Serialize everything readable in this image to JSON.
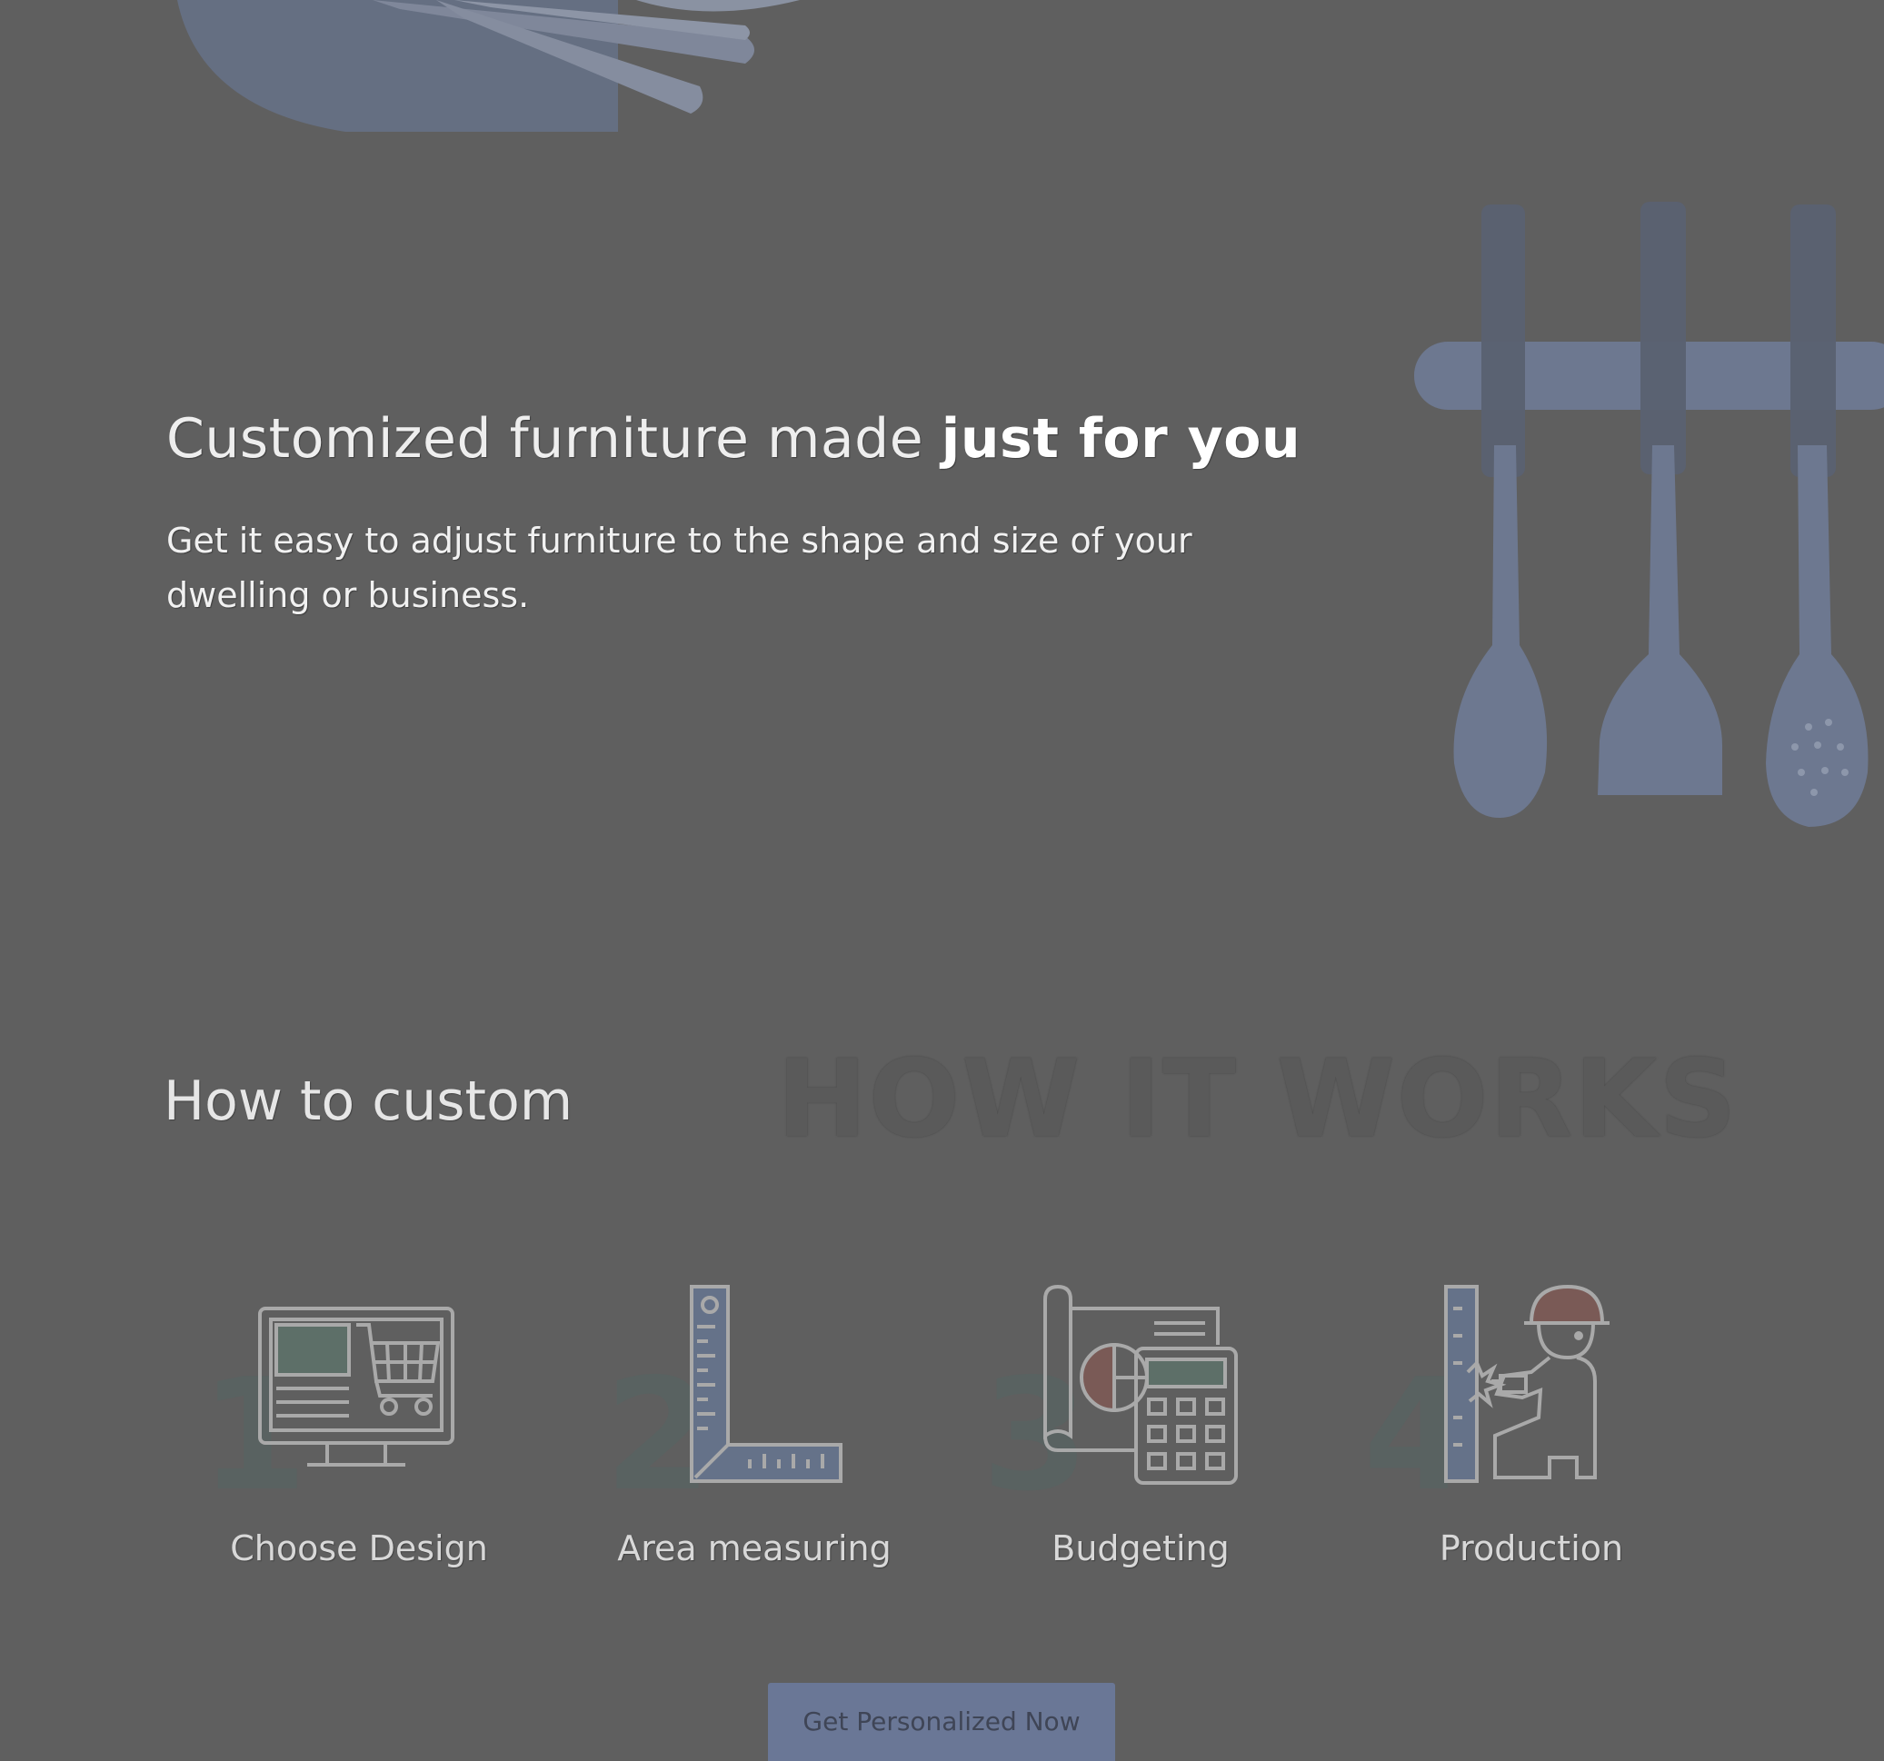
{
  "hero": {
    "title_light": "Customized furniture made ",
    "title_bold": "just for you",
    "subtitle": "Get it easy to adjust furniture to the shape and size of your dwelling or business."
  },
  "how_it_works": {
    "watermark": "HOW IT WORKS",
    "title": "How to custom",
    "steps": [
      {
        "number": "1",
        "label": "Choose Design",
        "icon": "monitor-cart-icon"
      },
      {
        "number": "2",
        "label": "Area measuring",
        "icon": "ruler-square-icon"
      },
      {
        "number": "3",
        "label": "Budgeting",
        "icon": "blueprint-calculator-icon"
      },
      {
        "number": "4",
        "label": "Production",
        "icon": "worker-hammer-icon"
      }
    ]
  },
  "cta": {
    "label": "Get Personalized Now"
  },
  "colors": {
    "background": "#5f5f5f",
    "cta_background": "#6a7796",
    "icon_stroke": "#a9a9a9",
    "icon_accent_green": "#5d6f68",
    "icon_accent_blue": "#657289",
    "icon_accent_red": "#7a5a56"
  }
}
